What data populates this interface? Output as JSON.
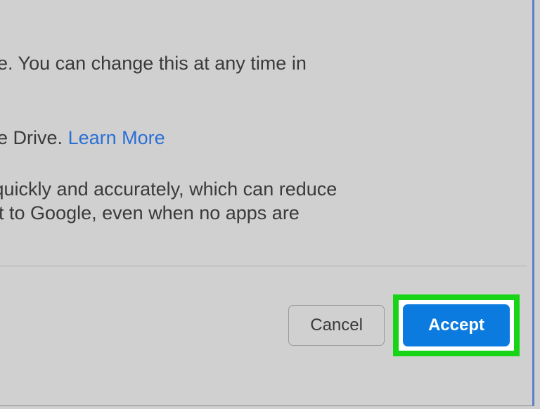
{
  "dialog": {
    "paragraph1": "ogle. You can change this at any time in",
    "paragraph2_prefix": "ogle Drive. ",
    "paragraph2_link": "Learn More",
    "paragraph3_line1": "n quickly and accurately, which can reduce",
    "paragraph3_line2": "ent to Google, even when no apps are",
    "buttons": {
      "cancel": "Cancel",
      "accept": "Accept"
    }
  },
  "colors": {
    "accent": "#0b7be0",
    "link": "#2a6fd6",
    "highlight": "#17d417"
  }
}
